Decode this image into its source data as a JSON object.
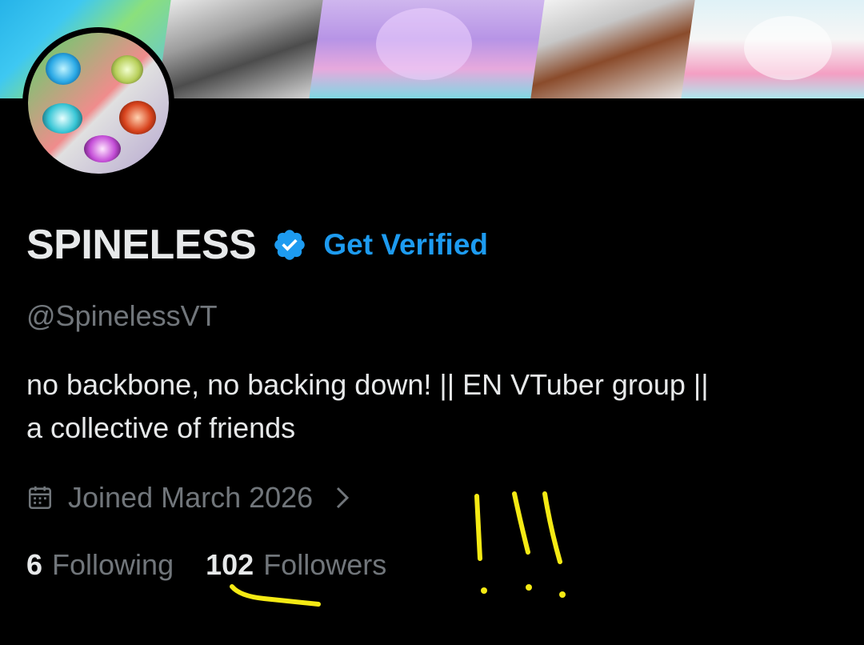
{
  "profile": {
    "display_name": "SPINELESS",
    "get_verified_label": "Get Verified",
    "handle": "@SpinelessVT",
    "bio_line1": "no backbone, no backing down! || EN VTuber group ||",
    "bio_line2": "a collective of friends",
    "joined": "Joined March 2026"
  },
  "stats": {
    "following_count": "6",
    "following_label": "Following",
    "followers_count": "102",
    "followers_label": "Followers"
  },
  "icons": {
    "verified_badge": "verified-badge-icon",
    "calendar": "calendar-icon",
    "chevron": "chevron-right-icon"
  },
  "colors": {
    "background": "#000000",
    "primary_text": "#e7e9ea",
    "secondary_text": "#71767b",
    "accent_blue": "#1d9bf0",
    "annotation_yellow": "#f5ea14"
  }
}
